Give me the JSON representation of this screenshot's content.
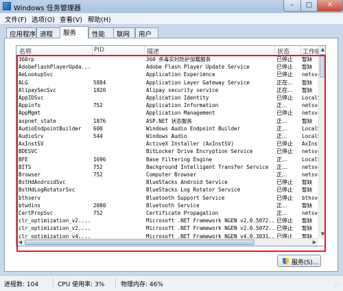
{
  "window": {
    "title": "Windows 任务管理器",
    "controls": {
      "minimize": "–",
      "maximize": "□",
      "close": "✕"
    }
  },
  "menu": [
    "文件(F)",
    "选项(O)",
    "查看(V)",
    "帮助(H)"
  ],
  "tabs": [
    "应用程序",
    "进程",
    "服务",
    "性能",
    "联网",
    "用户"
  ],
  "active_tab": "服务",
  "columns": [
    "名称",
    "PID",
    "描述",
    "状态",
    "工作组"
  ],
  "services": [
    {
      "name": "360rp",
      "pid": "",
      "desc": "360 杀毒实时防护加载服务",
      "status": "已停止",
      "group": "暂缺"
    },
    {
      "name": "AdobeFlashPlayerUpda...",
      "pid": "",
      "desc": "Adobe Flash Player Update Service",
      "status": "已停止",
      "group": "暂缺"
    },
    {
      "name": "AeLookupSvc",
      "pid": "",
      "desc": "Application Experience",
      "status": "已停止",
      "group": "netsvc"
    },
    {
      "name": "ALG",
      "pid": "5884",
      "desc": "Application Layer Gateway Service",
      "status": "正在...",
      "group": "暂缺"
    },
    {
      "name": "AlipaySecSvc",
      "pid": "1820",
      "desc": "Alipay security service",
      "status": "正在...",
      "group": "暂缺"
    },
    {
      "name": "AppIDSvc",
      "pid": "",
      "desc": "Application Identity",
      "status": "已停止",
      "group": "LocalS"
    },
    {
      "name": "Appinfo",
      "pid": "752",
      "desc": "Application Information",
      "status": "正...",
      "group": "netsvc"
    },
    {
      "name": "AppMgmt",
      "pid": "",
      "desc": "Application Management",
      "status": "已停止",
      "group": "netsvc"
    },
    {
      "name": "aspnet_state",
      "pid": "1876",
      "desc": "ASP.NET 状态服务",
      "status": "正...",
      "group": "暂缺"
    },
    {
      "name": "AudioEndpointBuilder",
      "pid": "600",
      "desc": "Windows Audio Endpoint Builder",
      "status": "正...",
      "group": "LocalS"
    },
    {
      "name": "AudioSrv",
      "pid": "544",
      "desc": "Windows Audio",
      "status": "正...",
      "group": "LocalS"
    },
    {
      "name": "AxInstSV",
      "pid": "",
      "desc": "ActiveX Installer (AxInstSV)",
      "status": "已停止",
      "group": "AxInst"
    },
    {
      "name": "BDESVC",
      "pid": "",
      "desc": "BitLocker Drive Encryption Service",
      "status": "已停止",
      "group": "netsvc"
    },
    {
      "name": "BFE",
      "pid": "1696",
      "desc": "Base Filtering Engine",
      "status": "正...",
      "group": "LocalS"
    },
    {
      "name": "BITS",
      "pid": "752",
      "desc": "Background Intelligent Transfer Service",
      "status": "正...",
      "group": "netsvc"
    },
    {
      "name": "Browser",
      "pid": "752",
      "desc": "Computer Browser",
      "status": "正...",
      "group": "netsvc"
    },
    {
      "name": "BstHdAndroidSvc",
      "pid": "",
      "desc": "BlueStacks Android Service",
      "status": "已停止",
      "group": "暂缺"
    },
    {
      "name": "BstHdLogRotatorSvc",
      "pid": "",
      "desc": "BlueStacks Log Rotator Service",
      "status": "已停止",
      "group": "暂缺"
    },
    {
      "name": "bthserv",
      "pid": "",
      "desc": "Bluetooth Support Service",
      "status": "已停止",
      "group": "bthsvc"
    },
    {
      "name": "btwdins",
      "pid": "2080",
      "desc": "Bluetooth Service",
      "status": "正...",
      "group": "暂缺"
    },
    {
      "name": "CertPropSvc",
      "pid": "752",
      "desc": "Certificate Propagation",
      "status": "正...",
      "group": "netsvc"
    },
    {
      "name": "clr_optimization_v2....",
      "pid": "",
      "desc": "Microsoft .NET Framework NGEN v2.0.5072...",
      "status": "已停止",
      "group": "暂缺"
    },
    {
      "name": "clr_optimization_v2....",
      "pid": "",
      "desc": "Microsoft .NET Framework NGEN v2.0.5072...",
      "status": "已停止",
      "group": "暂缺"
    },
    {
      "name": "clr_optimization_v4....",
      "pid": "",
      "desc": "Microsoft .NET Framework NGEN v4.0.3031...",
      "status": "已停止",
      "group": "暂缺"
    }
  ],
  "services_button": "服务(S)...",
  "status": {
    "processes": "进程数: 104",
    "cpu": "CPU 使用率: 3%",
    "memory": "物理内存: 46%"
  },
  "colors": {
    "highlight": "#e11b22"
  }
}
